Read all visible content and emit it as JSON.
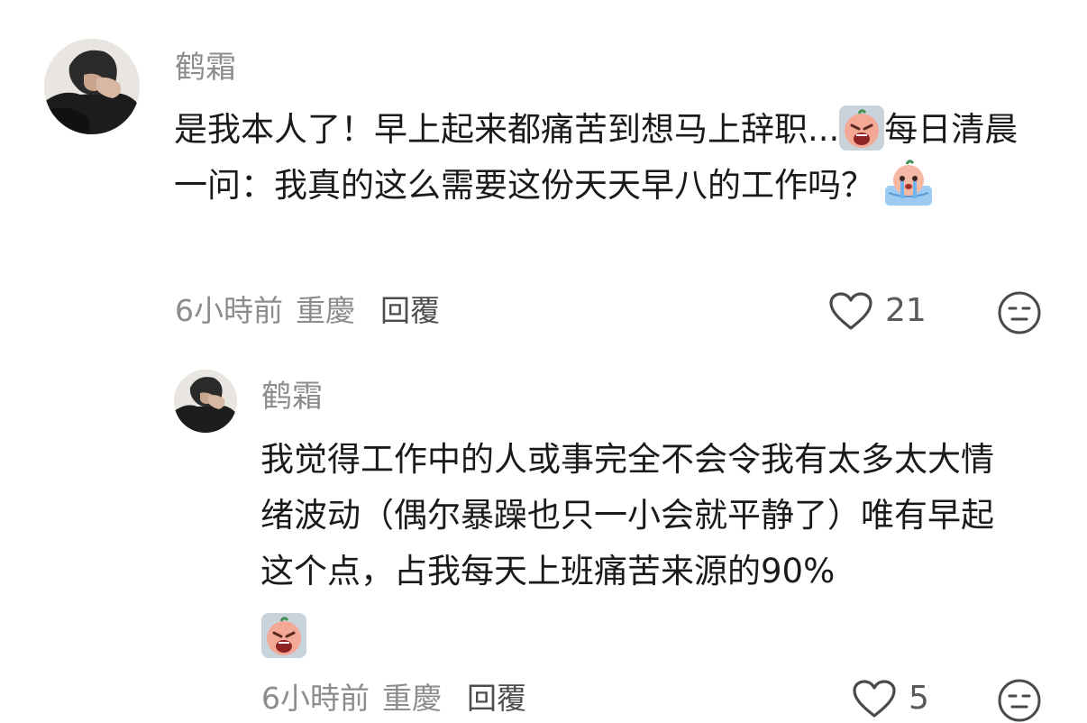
{
  "comment": {
    "username": "鹤霜",
    "text_before_emoji": "是我本人了！早上起来都痛苦到想马上辞职...",
    "text_after_emoji": "每日清晨一问：我真的这么需要这份天天早八的工作吗？",
    "time": "6小時前",
    "location": "重慶",
    "reply_label": "回覆",
    "likes": "21"
  },
  "reply": {
    "username": "鹤霜",
    "text": "我觉得工作中的人或事完全不会令我有太多太大情绪波动（偶尔暴躁也只一小会就平静了）唯有早起这个点，占我每天上班痛苦来源的90%",
    "time": "6小時前",
    "location": "重慶",
    "reply_label": "回覆",
    "likes": "5"
  },
  "icons": {
    "like": "heart-outline-icon",
    "dislike": "neutral-face-icon",
    "crying_emoji": "crying-peach-emoji",
    "sob_emoji": "sobbing-peach-emoji"
  },
  "colors": {
    "text": "#1a1a1a",
    "secondary": "#8c8c8c",
    "reply_button": "#4d4d4d"
  }
}
